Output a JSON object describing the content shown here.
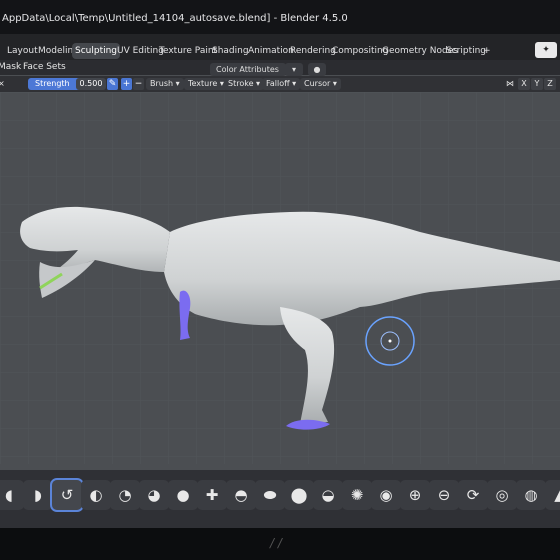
{
  "window": {
    "title": "AppData\\Local\\Temp\\Untitled_14104_autosave.blend] - Blender 4.5.0"
  },
  "workspace_tabs": [
    {
      "label": "Layout"
    },
    {
      "label": "Modeling"
    },
    {
      "label": "Sculpting",
      "active": true
    },
    {
      "label": "UV Editing"
    },
    {
      "label": "Texture Paint"
    },
    {
      "label": "Shading"
    },
    {
      "label": "Animation"
    },
    {
      "label": "Rendering"
    },
    {
      "label": "Compositing"
    },
    {
      "label": "Geometry Nodes"
    },
    {
      "label": "Scripting"
    },
    {
      "label": "+"
    }
  ],
  "mode_row": {
    "mask": "Mask",
    "face_sets": "Face Sets",
    "color_attributes": "Color Attributes"
  },
  "tool_header": {
    "strength_label": "Strength",
    "strength_value": "0.500",
    "brush": "Brush",
    "texture": "Texture",
    "stroke": "Stroke",
    "falloff": "Falloff",
    "cursor": "Cursor",
    "axis_x": "X",
    "axis_y": "Y",
    "axis_z": "Z"
  },
  "colors": {
    "accent": "#4c78d6",
    "mask_purple": "#7b6cf0",
    "model_grey": "#d2d5d6",
    "viewport_bg": "#4b4e52"
  },
  "toolbar_icons": [
    "draw-brush-icon",
    "draw-sharp-icon",
    "clay-icon",
    "clay-strips-icon",
    "layer-icon",
    "inflate-icon",
    "blob-icon",
    "crease-icon",
    "smooth-icon",
    "flatten-icon",
    "fill-icon",
    "scrape-icon",
    "multiplane-scrape-icon",
    "pinch-icon",
    "grab-icon",
    "elastic-deform-icon",
    "snake-hook-icon",
    "thumb-icon",
    "pose-icon",
    "nudge-icon"
  ]
}
